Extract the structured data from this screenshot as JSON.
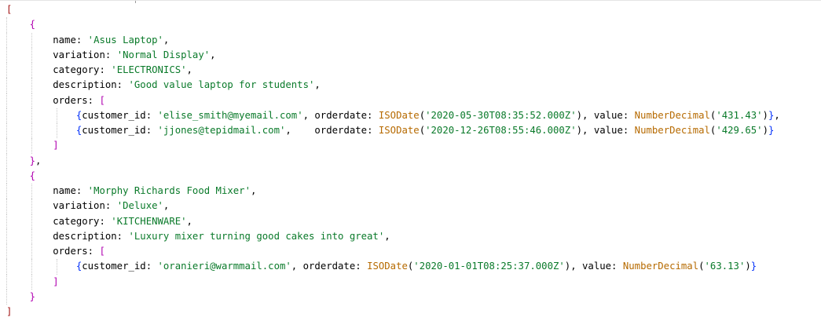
{
  "documents": [
    {
      "name": "Asus Laptop",
      "variation": "Normal Display",
      "category": "ELECTRONICS",
      "description": "Good value laptop for students",
      "orders": [
        {
          "customer_id": "elise_smith@myemail.com",
          "orderdate": "2020-05-30T08:35:52.000Z",
          "value": "431.43"
        },
        {
          "customer_id": "jjones@tepidmail.com",
          "orderdate": "2020-12-26T08:55:46.000Z",
          "value": "429.65"
        }
      ]
    },
    {
      "name": "Morphy Richards Food Mixer",
      "variation": "Deluxe",
      "category": "KITCHENWARE",
      "description": "Luxury mixer turning good cakes into great",
      "orders": [
        {
          "customer_id": "oranieri@warmmail.com",
          "orderdate": "2020-01-01T08:25:37.000Z",
          "value": "63.13"
        }
      ]
    }
  ],
  "syntax": {
    "keys": {
      "name": "name",
      "variation": "variation",
      "category": "category",
      "description": "description",
      "orders": "orders",
      "customer_id": "customer_id",
      "orderdate": "orderdate",
      "value": "value"
    },
    "functions": {
      "date": "ISODate",
      "decimal": "NumberDecimal"
    }
  },
  "colors": {
    "outer_bracket": "#a31515",
    "object_brace": "#b000b0",
    "inner_brace": "#0431fa",
    "string": "#0a7a2a",
    "function": "#b66a00",
    "indent_guide": "#c8c8c8"
  }
}
